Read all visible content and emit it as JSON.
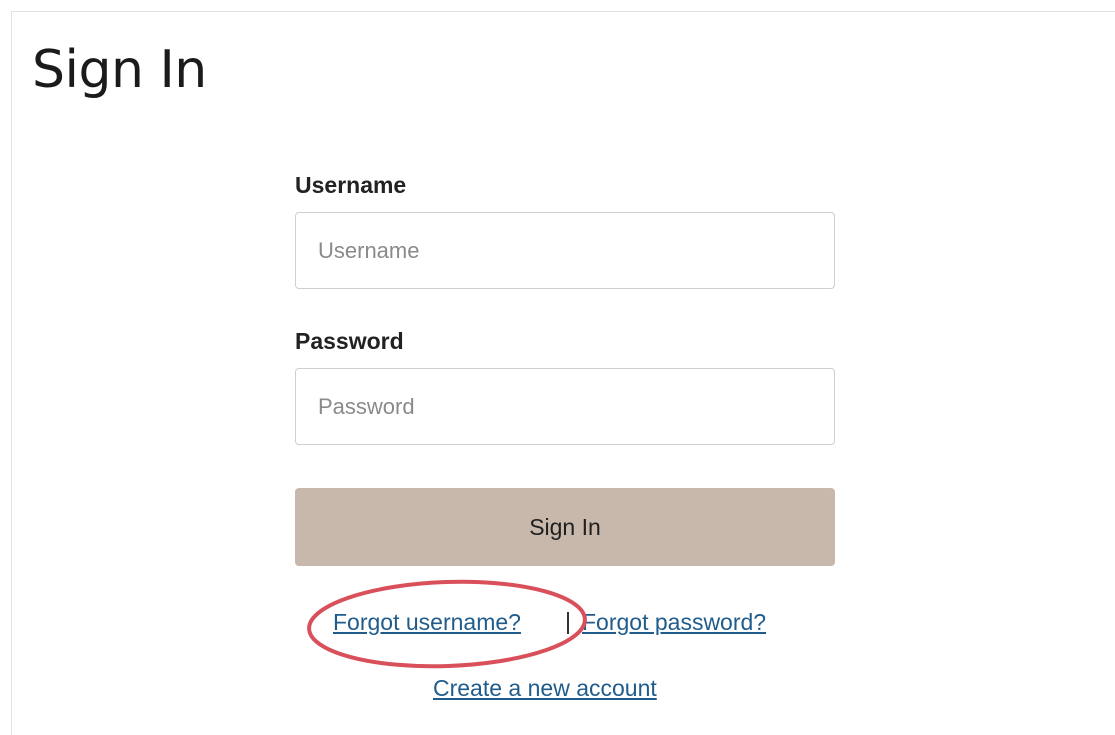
{
  "page": {
    "title": "Sign In"
  },
  "form": {
    "username": {
      "label": "Username",
      "placeholder": "Username",
      "value": ""
    },
    "password": {
      "label": "Password",
      "placeholder": "Password",
      "value": ""
    },
    "submit_label": "Sign In"
  },
  "links": {
    "forgot_username": "Forgot username?",
    "forgot_password": "Forgot password?",
    "create_account": "Create a new account"
  },
  "colors": {
    "button_background": "#c8b8ab",
    "link": "#1f5c8c",
    "highlight_ring": "#d9505a"
  }
}
